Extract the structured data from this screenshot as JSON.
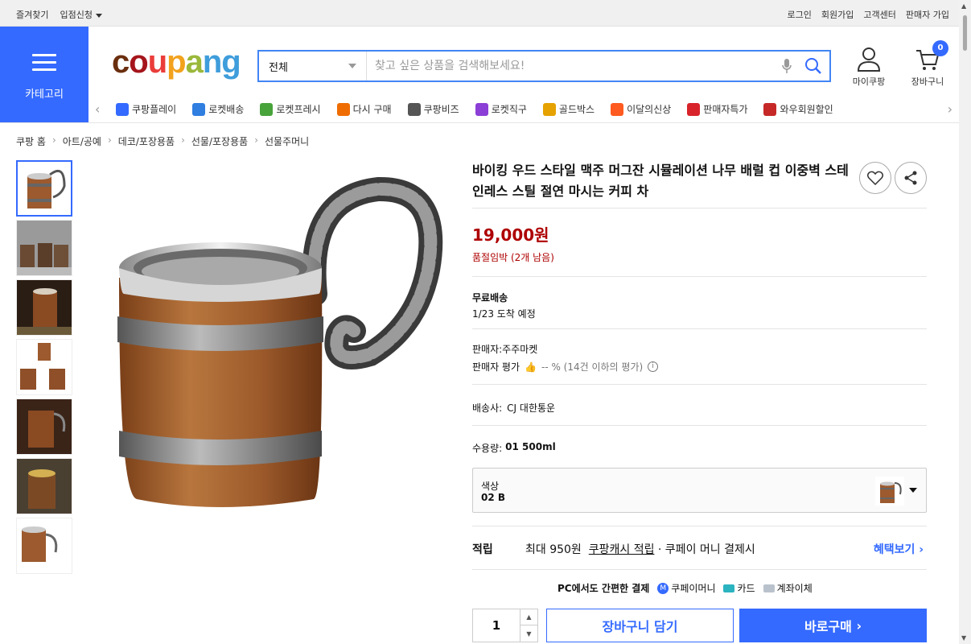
{
  "topbar": {
    "left": [
      "즐겨찾기",
      "입점신청"
    ],
    "right": [
      "로그인",
      "회원가입",
      "고객센터",
      "판매자 가입"
    ]
  },
  "category_button": {
    "label": "카테고리"
  },
  "logo": {
    "letters": [
      "c",
      "o",
      "u",
      "p",
      "a",
      "n",
      "g"
    ],
    "colors": [
      "#6a2e0e",
      "#a5151c",
      "#ea3d3a",
      "#f2a21d",
      "#9ab83a",
      "#3f9ddb",
      "#3f9ddb"
    ]
  },
  "search": {
    "category": "전체",
    "placeholder": "찾고 싶은 상품을 검색해보세요!"
  },
  "header": {
    "my_label": "마이쿠팡",
    "cart_label": "장바구니",
    "cart_count": "0"
  },
  "nav_items": [
    {
      "label": "쿠팡플레이",
      "icon": "play-icon",
      "color": "#346aff"
    },
    {
      "label": "로켓배송",
      "icon": "rocket-icon",
      "color": "#2f7ee0"
    },
    {
      "label": "로켓프레시",
      "icon": "rocket-fresh-icon",
      "color": "#47a33a"
    },
    {
      "label": "다시 구매",
      "icon": "repurchase-icon",
      "color": "#ef6c00"
    },
    {
      "label": "쿠팡비즈",
      "icon": "biz-icon",
      "color": "#555555"
    },
    {
      "label": "로켓직구",
      "icon": "rocket-global-icon",
      "color": "#8c3fd6"
    },
    {
      "label": "골드박스",
      "icon": "goldbox-icon",
      "color": "#e5a200"
    },
    {
      "label": "이달의신상",
      "icon": "new-icon",
      "color": "#ff5a1f"
    },
    {
      "label": "판매자특가",
      "icon": "discount-icon",
      "color": "#d8232a"
    },
    {
      "label": "와우회원할인",
      "icon": "wow-icon",
      "color": "#c62828"
    }
  ],
  "breadcrumb": [
    "쿠팡 홈",
    "아트/공예",
    "데코/포장용품",
    "선물/포장용품",
    "선물주머니"
  ],
  "product": {
    "title": "바이킹 우드 스타일 맥주 머그잔 시뮬레이션 나무 배럴 컵 이중벽 스테인레스 스틸 절연 마시는 커피 차",
    "price": "19,000원",
    "stock": "품절임박 (2개 남음)",
    "shipping_title": "무료배송",
    "arrival": "1/23 도착 예정",
    "seller": "판매자:주주마켓",
    "seller_rating_label": "판매자 평가",
    "seller_rating_value": "-- % (14건 이하의 평가)",
    "carrier_label": "배송사:",
    "carrier": "CJ 대한통운",
    "capacity_label": "수용량:",
    "capacity": "01 500ml",
    "option_label": "색상",
    "option_value": "02 B",
    "reward_label": "적립",
    "reward_max": "최대 950원",
    "reward_link": "쿠팡캐시 적립",
    "reward_cond": "· 쿠페이 머니 결제시",
    "reward_more": "혜택보기",
    "pay_title": "PC에서도 간편한 결제",
    "pay_methods": [
      "쿠페이머니",
      "카드",
      "계좌이체"
    ],
    "quantity": "1",
    "cart_button": "장바구니 담기",
    "buy_button": "바로구매"
  }
}
